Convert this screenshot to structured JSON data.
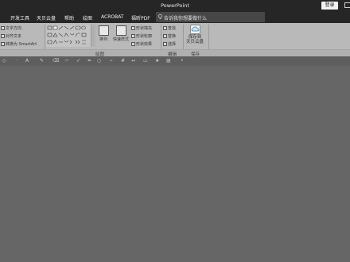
{
  "window": {
    "title": "PowerPoint",
    "login_label": "登录"
  },
  "tabs": [
    "开发工具",
    "天贝云盘",
    "帮助",
    "绘图",
    "ACROBAT",
    "福昕PDF"
  ],
  "search": {
    "placeholder": "告诉我你想要做什么"
  },
  "ribbon": {
    "paragraph": {
      "text_direction": "文字方向",
      "align_text": "对齐文本",
      "convert_smartart": "转换为 SmartArt"
    },
    "drawing": {
      "group_label": "绘图",
      "arrange": "排列",
      "quick_styles": "快速样式",
      "shape_fill": "形状填充",
      "shape_outline": "形状轮廓",
      "shape_effects": "形状效果"
    },
    "editing": {
      "group_label": "编辑",
      "find": "查找",
      "replace": "替换",
      "select": "选择"
    },
    "cloud": {
      "save_line1": "保存到",
      "save_line2": "天贝云盘",
      "group_label": "保存"
    }
  },
  "colors": {
    "titlebar": "#262626",
    "ribbon": "#b9b9b9",
    "canvas": "#666666"
  },
  "icons": [
    "lightbulb-icon",
    "cloud-icon",
    "text-direction-icon",
    "align-text-icon",
    "smartart-icon",
    "shapes-gallery-icon",
    "arrange-icon",
    "quick-styles-icon",
    "fill-icon",
    "outline-icon",
    "effects-icon",
    "find-icon",
    "replace-icon",
    "select-icon"
  ]
}
